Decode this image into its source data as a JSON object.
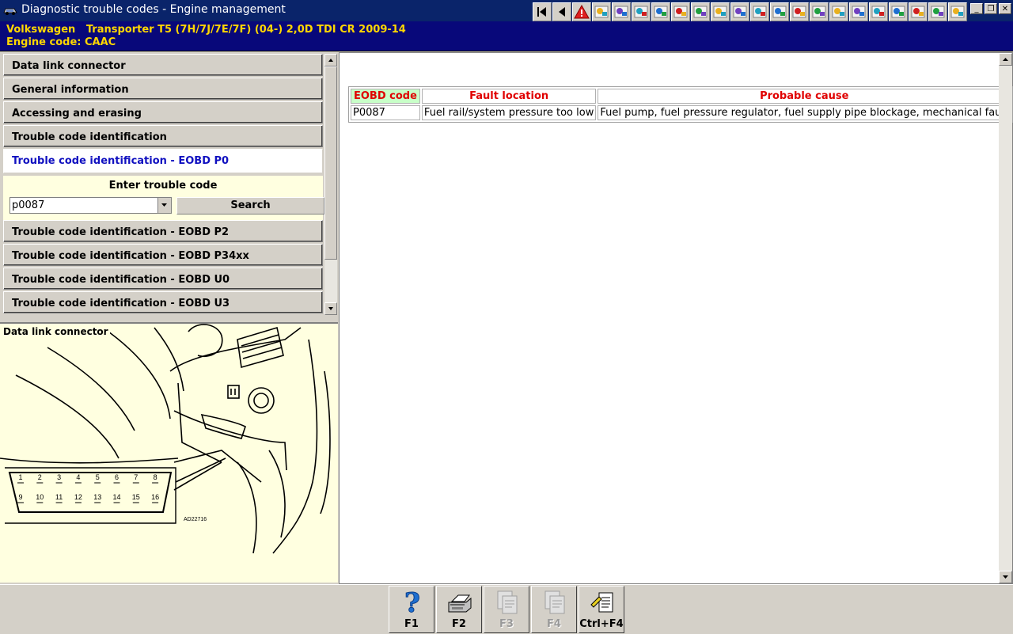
{
  "window": {
    "title": "Diagnostic trouble codes - Engine management",
    "toolbar_icons": [
      "first-page-icon",
      "previous-icon",
      "warning-icon",
      "document-icon",
      "tools-icon",
      "engine-icon",
      "gears-icon",
      "clock-icon",
      "wiring-icon",
      "components-icon",
      "lift-icon",
      "mechanic-icon",
      "tool-icon",
      "service-icon",
      "car-icon",
      "car-icon",
      "wrench-icon",
      "car-damage-icon",
      "person-icon",
      "triangle-icon",
      "car-parts-icon",
      "list-icon"
    ],
    "controls": [
      "_",
      "❐",
      "✕"
    ]
  },
  "vehicle": {
    "line1": "Volkswagen   Transporter T5 (7H/7J/7E/7F) (04-) 2,0D TDI CR 2009-14",
    "line2": "Engine code: CAAC"
  },
  "nav": {
    "items": [
      {
        "label": "Data link connector"
      },
      {
        "label": "General information"
      },
      {
        "label": "Accessing and erasing"
      },
      {
        "label": "Trouble code identification"
      },
      {
        "label": "Trouble code identification - EOBD P0"
      },
      {
        "label": "Trouble code identification - EOBD P2"
      },
      {
        "label": "Trouble code identification - EOBD P34xx"
      },
      {
        "label": "Trouble code identification - EOBD U0"
      },
      {
        "label": "Trouble code identification - EOBD U3"
      }
    ],
    "active_index": 4,
    "search": {
      "title": "Enter trouble code",
      "value": "p0087",
      "button_label": "Search"
    }
  },
  "picture": {
    "caption": "Data link connector",
    "pins_top": [
      "1",
      "2",
      "3",
      "4",
      "5",
      "6",
      "7",
      "8"
    ],
    "pins_bottom": [
      "9",
      "10",
      "11",
      "12",
      "13",
      "14",
      "15",
      "16"
    ],
    "ref_code": "AD22716"
  },
  "results": {
    "headers": [
      "EOBD code",
      "Fault location",
      "Probable cause"
    ],
    "rows": [
      [
        "P0087",
        "Fuel rail/system pressure too low",
        "Fuel pump, fuel pressure regulator, fuel supply pipe blockage, mechanical fault"
      ]
    ]
  },
  "function_keys": [
    {
      "label": "F1",
      "icon": "help-icon",
      "enabled": true
    },
    {
      "label": "F2",
      "icon": "print-icon",
      "enabled": true
    },
    {
      "label": "F3",
      "icon": "print-preview-icon",
      "enabled": false
    },
    {
      "label": "F4",
      "icon": "print-all-icon",
      "enabled": false
    },
    {
      "label": "Ctrl+F4",
      "icon": "notes-icon",
      "enabled": true
    }
  ],
  "colors": {
    "title_bar": "#0a246a",
    "vehicle_bar": "#08087a",
    "vehicle_text": "#ffd700",
    "active_nav_text": "#1010c0",
    "table_header_text": "#e00000",
    "first_header_bg": "#c8ffc8",
    "panel_bg": "#ffffe0"
  }
}
